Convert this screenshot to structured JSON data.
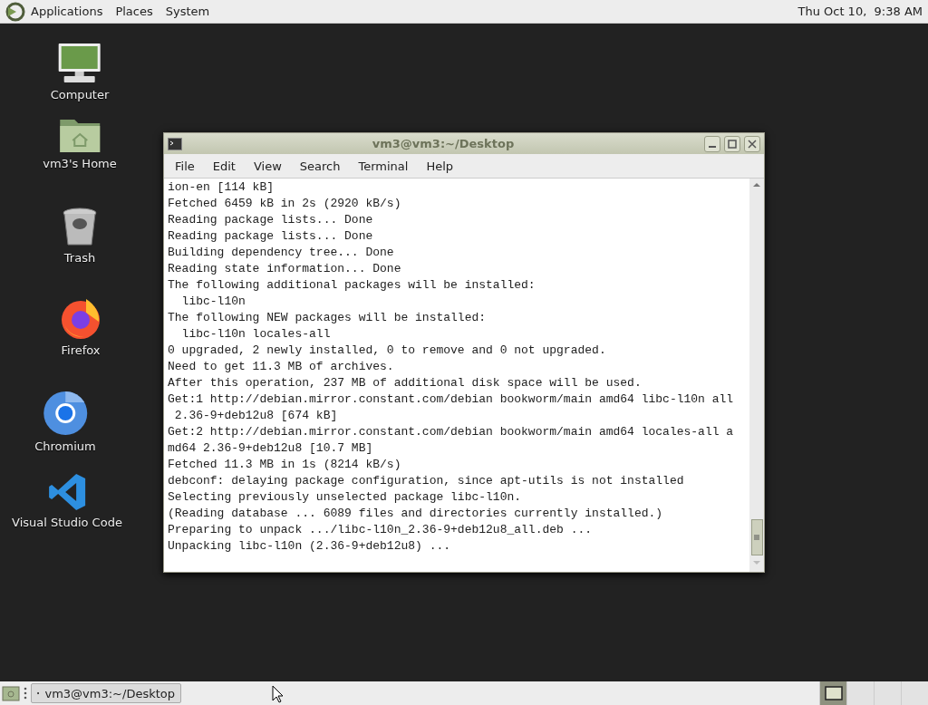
{
  "top_panel": {
    "menus": [
      "Applications",
      "Places",
      "System"
    ],
    "clock": "Thu Oct 10,  9:38 AM"
  },
  "desktop_icons": [
    {
      "kind": "computer",
      "label": "Computer"
    },
    {
      "kind": "home",
      "label": "vm3's Home"
    },
    {
      "kind": "trash",
      "label": "Trash"
    },
    {
      "kind": "firefox",
      "label": "Firefox"
    },
    {
      "kind": "chromium",
      "label": "Chromium"
    },
    {
      "kind": "vscode",
      "label": "Visual Studio Code"
    }
  ],
  "window": {
    "title": "vm3@vm3:~/Desktop",
    "menu": [
      "File",
      "Edit",
      "View",
      "Search",
      "Terminal",
      "Help"
    ],
    "lines": [
      "ion-en [114 kB]",
      "Fetched 6459 kB in 2s (2920 kB/s)",
      "Reading package lists... Done",
      "Reading package lists... Done",
      "Building dependency tree... Done",
      "Reading state information... Done",
      "The following additional packages will be installed:",
      "  libc-l10n",
      "The following NEW packages will be installed:",
      "  libc-l10n locales-all",
      "0 upgraded, 2 newly installed, 0 to remove and 0 not upgraded.",
      "Need to get 11.3 MB of archives.",
      "After this operation, 237 MB of additional disk space will be used.",
      "Get:1 http://debian.mirror.constant.com/debian bookworm/main amd64 libc-l10n all",
      " 2.36-9+deb12u8 [674 kB]",
      "Get:2 http://debian.mirror.constant.com/debian bookworm/main amd64 locales-all a",
      "md64 2.36-9+deb12u8 [10.7 MB]",
      "Fetched 11.3 MB in 1s (8214 kB/s)",
      "debconf: delaying package configuration, since apt-utils is not installed",
      "Selecting previously unselected package libc-l10n.",
      "(Reading database ... 6089 files and directories currently installed.)",
      "Preparing to unpack .../libc-l10n_2.36-9+deb12u8_all.deb ...",
      "Unpacking libc-l10n (2.36-9+deb12u8) ..."
    ]
  },
  "bottom_panel": {
    "tasks": [
      {
        "label": "vm3@vm3:~/Desktop",
        "selected": false
      }
    ],
    "workspaces": [
      {
        "selected": true
      },
      {
        "selected": false
      },
      {
        "selected": false
      },
      {
        "selected": false
      }
    ]
  }
}
